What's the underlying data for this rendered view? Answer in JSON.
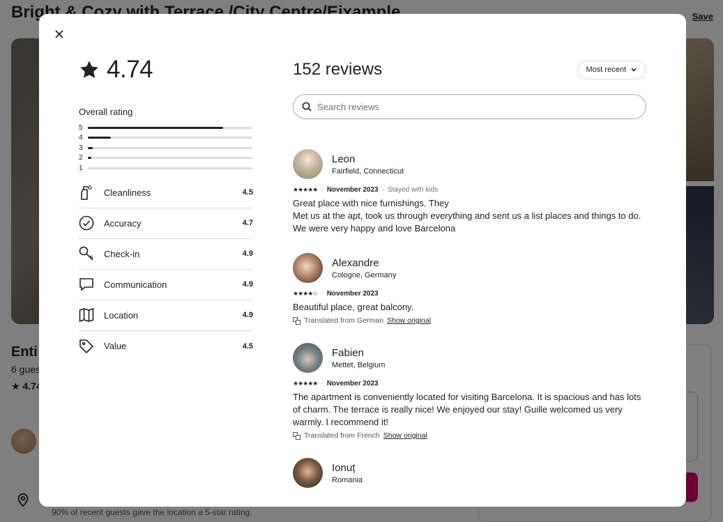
{
  "listing": {
    "title": "Bright & Cozy with Terrace /City Centre/Eixample",
    "save_label": "Save",
    "subtitle": "Enti",
    "guests": "6 gues",
    "rating": "4.74",
    "location_note": "90% of recent guests gave the location a 5-star rating."
  },
  "modal": {
    "overall_score": "4.74",
    "overall_rating_label": "Overall rating",
    "distribution": [
      {
        "stars": "5",
        "fraction": 0.82
      },
      {
        "stars": "4",
        "fraction": 0.14
      },
      {
        "stars": "3",
        "fraction": 0.03
      },
      {
        "stars": "2",
        "fraction": 0.02
      },
      {
        "stars": "1",
        "fraction": 0.0
      }
    ],
    "categories": [
      {
        "name": "Cleanliness",
        "value": "4.5",
        "icon": "spray-bottle-icon"
      },
      {
        "name": "Accuracy",
        "value": "4.7",
        "icon": "check-circle-icon"
      },
      {
        "name": "Check-in",
        "value": "4.9",
        "icon": "key-icon"
      },
      {
        "name": "Communication",
        "value": "4.9",
        "icon": "chat-bubble-icon"
      },
      {
        "name": "Location",
        "value": "4.9",
        "icon": "map-icon"
      },
      {
        "name": "Value",
        "value": "4.5",
        "icon": "tag-icon"
      }
    ],
    "reviews_title": "152 reviews",
    "sort_label": "Most recent",
    "search_placeholder": "Search reviews",
    "reviews": [
      {
        "name": "Leon",
        "location": "Fairfield, Connecticut",
        "stars": "★★★★★",
        "date": "November 2023",
        "stay": "Stayed with kids",
        "text": "Great place with nice furnishings. They\nMet us at the apt, took us through everything and sent us a list places and things to do.\nWe were very happy and love Barcelona",
        "translated": "",
        "show_original": ""
      },
      {
        "name": "Alexandre",
        "location": "Cologne, Germany",
        "stars": "★★★★☆",
        "date": "November 2023",
        "stay": "",
        "text": "Beautiful place, great balcony.",
        "translated": "Translated from German",
        "show_original": "Show original"
      },
      {
        "name": "Fabien",
        "location": "Mettet, Belgium",
        "stars": "★★★★★",
        "date": "November 2023",
        "stay": "",
        "text": "The apartment is conveniently located for visiting Barcelona. It is spacious and has lots of charm. The terrace is really nice! We enjoyed our stay! Guille welcomed us very warmly. I recommend it!",
        "translated": "Translated from French",
        "show_original": "Show original"
      },
      {
        "name": "Ionuț",
        "location": "Romania",
        "stars": "",
        "date": "",
        "stay": "",
        "text": "",
        "translated": "",
        "show_original": ""
      }
    ]
  }
}
